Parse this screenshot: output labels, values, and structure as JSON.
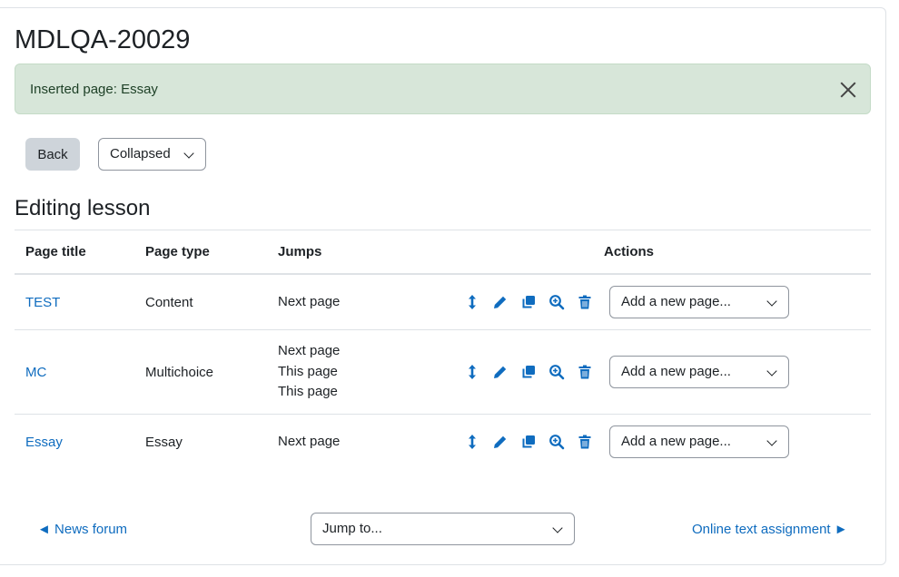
{
  "page": {
    "title": "MDLQA-20029"
  },
  "alert": {
    "message": "Inserted page: Essay"
  },
  "toolbar": {
    "back_label": "Back",
    "view_mode": "Collapsed"
  },
  "section": {
    "heading": "Editing lesson"
  },
  "table": {
    "headers": {
      "page_title": "Page title",
      "page_type": "Page type",
      "jumps": "Jumps",
      "actions": "Actions"
    },
    "rows": [
      {
        "title": "TEST",
        "type": "Content",
        "jumps": [
          "Next page"
        ],
        "add_page": "Add a new page..."
      },
      {
        "title": "MC",
        "type": "Multichoice",
        "jumps": [
          "Next page",
          "This page",
          "This page"
        ],
        "add_page": "Add a new page..."
      },
      {
        "title": "Essay",
        "type": "Essay",
        "jumps": [
          "Next page"
        ],
        "add_page": "Add a new page..."
      }
    ],
    "action_icons": [
      "move-icon",
      "edit-icon",
      "duplicate-icon",
      "preview-icon",
      "delete-icon"
    ]
  },
  "footer": {
    "prev_link": "◄ News forum",
    "jump_select": "Jump to...",
    "next_link": "Online text assignment ►"
  },
  "colors": {
    "link": "#0f6cbf",
    "alert_bg": "#d7e6d9",
    "button_bg": "#ced4da"
  }
}
